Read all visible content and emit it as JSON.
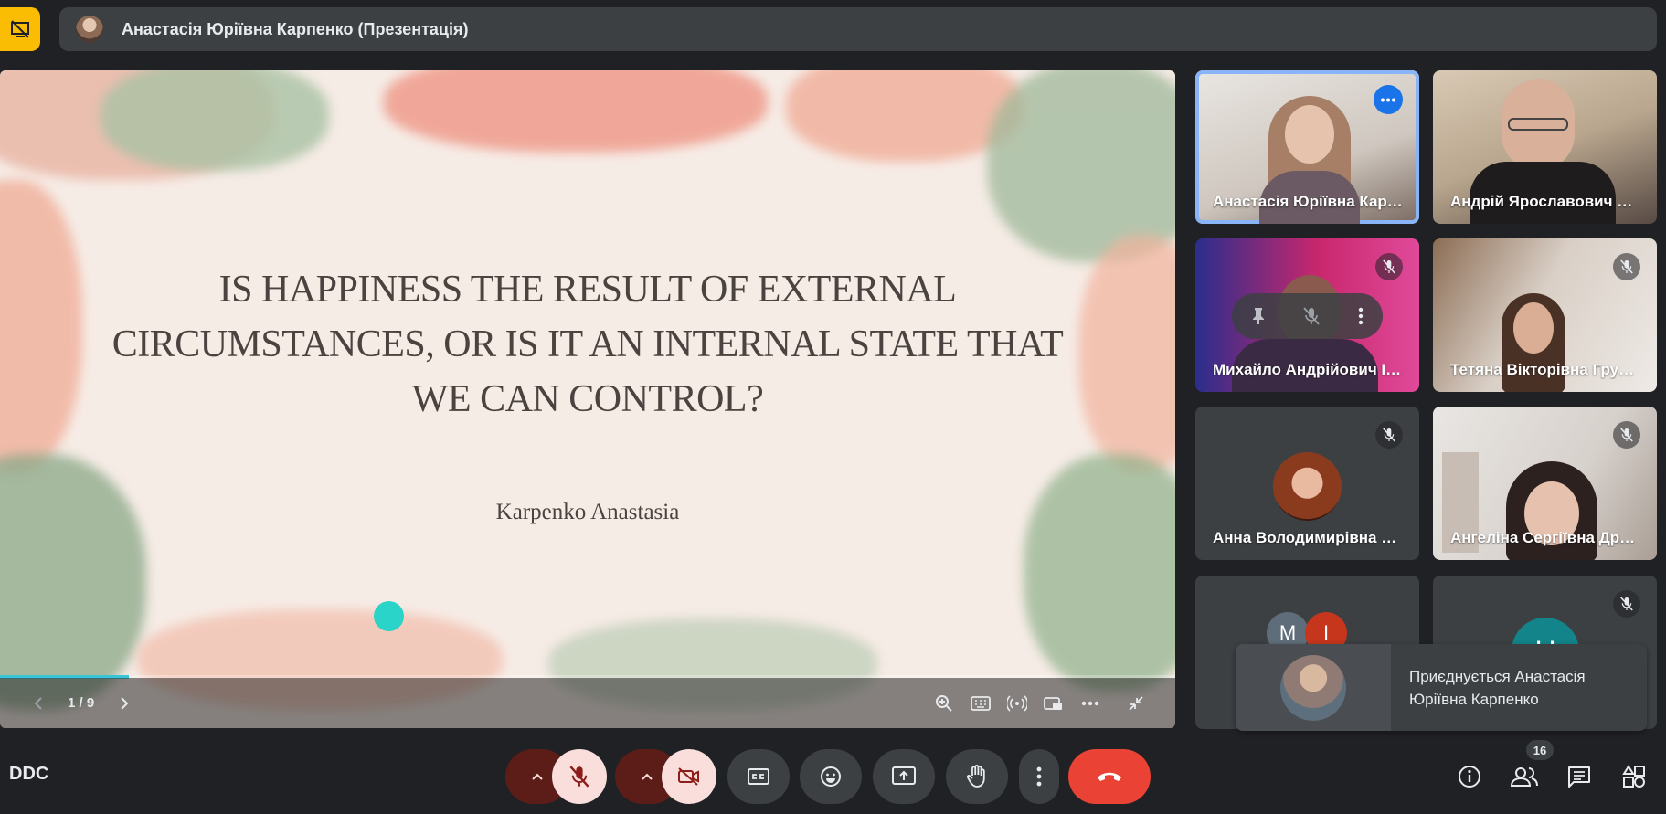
{
  "top_bar": {
    "title": "Анастасія Юріївна Карпенко (Презентація)"
  },
  "slide": {
    "question": "IS HAPPINESS THE RESULT OF EXTERNAL CIRCUMSTANCES, OR IS IT AN INTERNAL STATE THAT WE CAN CONTROL?",
    "author": "Karpenko Anastasia",
    "page_indicator": "1 / 9",
    "progress_fraction": 0.11
  },
  "participants": [
    {
      "name": "Анастасія Юріївна Карпенко",
      "muted": false,
      "active": true
    },
    {
      "name": "Андрій Ярославович Пономаренко",
      "muted": false,
      "active": false
    },
    {
      "name": "Михайло Андрійович Іваненко",
      "muted": true,
      "active": false
    },
    {
      "name": "Тетяна Вікторівна Грушко",
      "muted": true,
      "active": false
    },
    {
      "name": "Анна Володимирівна Шевченко",
      "muted": true,
      "active": false
    },
    {
      "name": "Ангеліна Сергіївна Дрозд",
      "muted": true,
      "active": false
    }
  ],
  "group_tile": {
    "initials": [
      "M",
      "I"
    ]
  },
  "extra_tile": {
    "initial": "Н"
  },
  "toast": {
    "text": "Приєднується Анастасія Юріївна Карпенко"
  },
  "bottom_bar": {
    "meeting_code": "DDC",
    "participant_count": "16"
  },
  "colors": {
    "accent_blue": "#8ab4f8",
    "hangup_red": "#ea4335",
    "present_yellow": "#fbbc04",
    "cursor_teal": "#2bd4c8"
  }
}
